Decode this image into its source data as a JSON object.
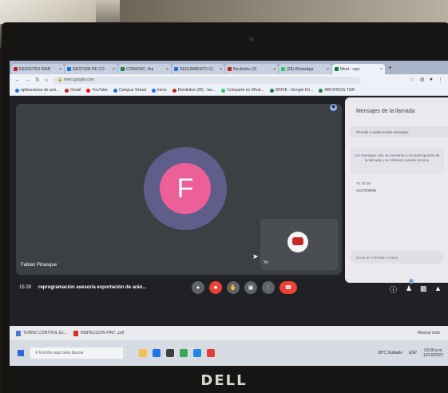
{
  "laptop": {
    "brand": "DELL"
  },
  "browser": {
    "tabs": [
      {
        "label": "REGISTRO DIAR",
        "favicon_color": "#c5221f"
      },
      {
        "label": "GESTION DE CO",
        "favicon_color": "#1a73e8"
      },
      {
        "label": "COMUNIC. Hoj",
        "favicon_color": "#188038"
      },
      {
        "label": "SEGUIMIENTO CL",
        "favicon_color": "#1a73e8"
      },
      {
        "label": "Recibidos (2)",
        "favicon_color": "#c5221f"
      },
      {
        "label": "(28) WhatsApp",
        "favicon_color": "#25d366"
      },
      {
        "label": "Meet - repr",
        "favicon_color": "#00832d",
        "active": true
      }
    ],
    "url": "meet.google.com",
    "bookmarks": [
      {
        "label": "aplicaciones de ami...",
        "color": "#1a73e8"
      },
      {
        "label": "Gmail",
        "color": "#c5221f"
      },
      {
        "label": "YouTube",
        "color": "#ff0000"
      },
      {
        "label": "Campus Virtual",
        "color": "#1a73e8"
      },
      {
        "label": "Inicio",
        "color": "#1a73e8"
      },
      {
        "label": "Recibidos (28) - Ian...",
        "color": "#c5221f"
      },
      {
        "label": "Compartir en What...",
        "color": "#25d366"
      },
      {
        "label": "DRIVE - Google Dri...",
        "color": "#188038"
      },
      {
        "label": "ARCHIVOS TUR",
        "color": "#188038"
      }
    ]
  },
  "meet": {
    "speaker_initial": "F",
    "speaker_name": "Fabian Pinasque",
    "self_label": "Yo",
    "clock": "15:28",
    "meeting_title": "reprogramación asesoria exportación de arán...",
    "chat": {
      "title": "Mensajes de la llamada",
      "toggle_text": "Permitir a todos enviar mensajes",
      "notice": "Los mensajes solo se muestran a los participantes de la llamada y se eliminan cuando termina",
      "sender": "Tú 15:19",
      "message": "ACOTORRE",
      "input_placeholder": "Envía un mensaje a todos"
    },
    "controls": [
      "mic-icon",
      "camera-off-icon",
      "raise-hand-icon",
      "present-icon",
      "more-icon",
      "hangup-icon"
    ],
    "participants_badge": "2"
  },
  "downloads": {
    "items": [
      "TURNO CONTROL Ex...",
      "INSPECCION FINT...pdf"
    ],
    "show_all": "Mostrar todo"
  },
  "taskbar": {
    "search_placeholder": "Escribe aquí para buscar",
    "weather": "18°C Nublado",
    "lang": "ESP",
    "time": "03:28 p.m.",
    "date": "12/10/2022"
  }
}
